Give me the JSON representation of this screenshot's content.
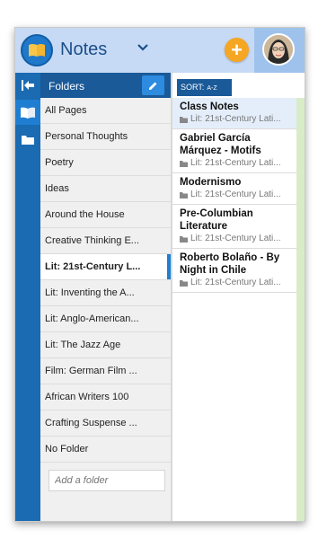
{
  "header": {
    "app_title": "Notes",
    "add_symbol": "+"
  },
  "folders": {
    "title": "Folders",
    "items": [
      {
        "label": "All Pages",
        "selected": false
      },
      {
        "label": "Personal Thoughts",
        "selected": false
      },
      {
        "label": "Poetry",
        "selected": false
      },
      {
        "label": "Ideas",
        "selected": false
      },
      {
        "label": "Around the House",
        "selected": false
      },
      {
        "label": "Creative Thinking E...",
        "selected": false
      },
      {
        "label": "Lit: 21st-Century L...",
        "selected": true
      },
      {
        "label": "Lit: Inventing the A...",
        "selected": false
      },
      {
        "label": "Lit: Anglo-American...",
        "selected": false
      },
      {
        "label": "Lit: The Jazz Age",
        "selected": false
      },
      {
        "label": "Film: German Film ...",
        "selected": false
      },
      {
        "label": "African Writers 100",
        "selected": false
      },
      {
        "label": "Crafting Suspense ...",
        "selected": false
      },
      {
        "label": "No Folder",
        "selected": false
      }
    ],
    "add_placeholder": "Add a folder"
  },
  "notes": {
    "sort_label": "SORT:",
    "sort_mode": "A-Z",
    "items": [
      {
        "title": "Class Notes",
        "folder": "Lit: 21st-Century Lati...",
        "selected": true
      },
      {
        "title": "Gabriel García Márquez - Motifs",
        "folder": "Lit: 21st-Century Lati...",
        "selected": false
      },
      {
        "title": "Modernismo",
        "folder": "Lit: 21st-Century Lati...",
        "selected": false
      },
      {
        "title": "Pre-Columbian Literature",
        "folder": "Lit: 21st-Century Lati...",
        "selected": false
      },
      {
        "title": "Roberto Bolaño - By Night in Chile",
        "folder": "Lit: 21st-Century Lati...",
        "selected": false
      }
    ]
  },
  "colors": {
    "header_bg": "#c7daf5",
    "rail_bg": "#1a6bb2",
    "folders_header_bg": "#1a5a99",
    "accent": "#1f7ed1",
    "add_button": "#f5a623"
  },
  "icons": {
    "logo": "notebook-icon",
    "collapse": "collapse-left-icon",
    "notebook": "notebook-icon",
    "folder": "folder-icon",
    "edit": "pencil-icon"
  }
}
